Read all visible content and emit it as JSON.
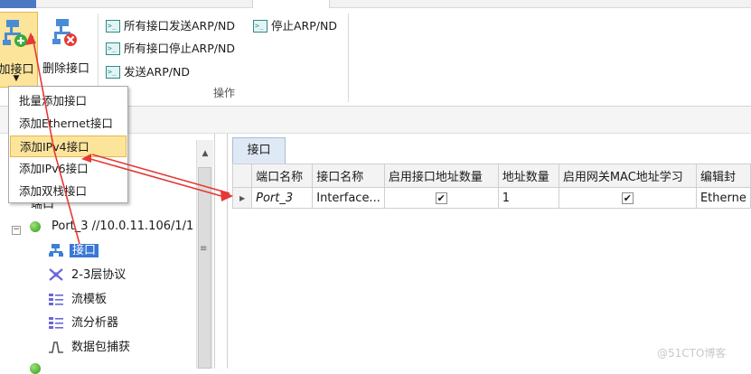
{
  "ribbon": {
    "add_interface": "加接口",
    "delete_interface": "删除接口",
    "send_all_arp": "所有接口发送ARP/ND",
    "stop_all_arp": "所有接口停止ARP/ND",
    "send_arp": "发送ARP/ND",
    "stop_arp": "停止ARP/ND",
    "group_label": "操作"
  },
  "menu": {
    "items": [
      "批量添加接口",
      "添加Ethernet接口",
      "添加IPv4接口",
      "添加IPv6接口",
      "添加双栈接口"
    ],
    "highlighted_index": 2
  },
  "tree": {
    "root_label": "端口",
    "port_label": "Port_3 //10.0.11.106/1/1",
    "children": [
      "接口",
      "2-3层协议",
      "流模板",
      "流分析器",
      "数据包捕获"
    ]
  },
  "panel": {
    "tab_label": "接口",
    "columns": [
      "端口名称",
      "接口名称",
      "启用接口地址数量",
      "地址数量",
      "启用网关MAC地址学习",
      "编辑封"
    ],
    "rows": [
      {
        "port_name": "Port_3",
        "interface_name": "Interface...",
        "enable_addr_count": "✔",
        "addr_count": "1",
        "enable_gw_mac": "✔",
        "encap": "Etherne"
      }
    ]
  },
  "watermark": "@51CTO博客",
  "colors": {
    "accent": "#3a77d6",
    "highlight": "#fde49b",
    "annotation": "#e53935"
  }
}
